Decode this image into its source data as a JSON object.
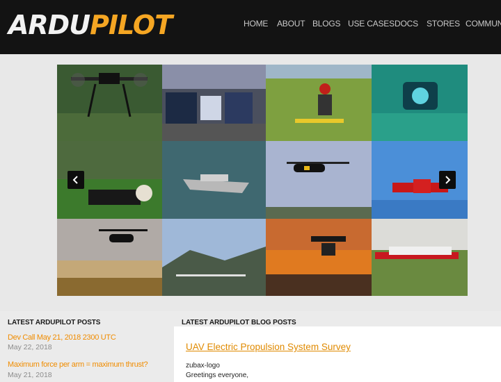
{
  "logo": {
    "part1": "ARDU",
    "part2": "PILOT"
  },
  "nav": [
    {
      "label": "HOME"
    },
    {
      "label": "ABOUT"
    },
    {
      "label": "BLOGS"
    },
    {
      "label": "USE CASES"
    },
    {
      "label": "DOCS"
    },
    {
      "label": "STORES"
    },
    {
      "label": "COMMUNITY"
    }
  ],
  "carousel": {
    "prev_icon": "chevron-left-icon",
    "next_icon": "chevron-right-icon"
  },
  "posts": {
    "title": "LATEST ARDUPILOT POSTS",
    "items": [
      {
        "title": "Dev Call May 21, 2018 2300 UTC",
        "date": "May 22, 2018"
      },
      {
        "title": "Maximum force per arm = maximum thrust?",
        "date": "May 21, 2018"
      }
    ]
  },
  "blog": {
    "title": "LATEST ARDUPILOT BLOG POSTS",
    "post_title": "UAV Electric Propulsion System Survey",
    "line1": "zubax-logo",
    "line2": "Greetings everyone,"
  },
  "colors": {
    "header_bg": "#131313",
    "accent": "#f5a623",
    "link": "#f08c00"
  }
}
